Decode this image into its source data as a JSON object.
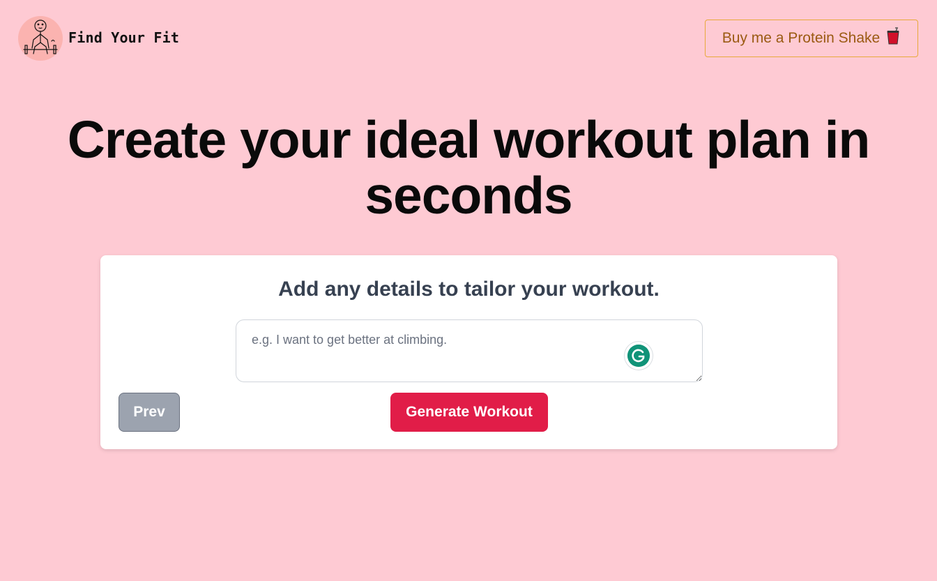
{
  "header": {
    "brand": "Find Your Fit",
    "logo_icon": "weightlifter-icon",
    "shake_button_label": "Buy me a Protein Shake",
    "shake_icon": "cup-icon"
  },
  "hero": {
    "title": "Create your ideal workout plan in seconds"
  },
  "card": {
    "title": "Add any details to tailor your workout.",
    "details_placeholder": "e.g. I want to get better at climbing.",
    "details_value": "",
    "prev_label": "Prev",
    "generate_label": "Generate Workout",
    "assistant_icon": "grammarly-icon"
  },
  "colors": {
    "background": "#fecad3",
    "accent": "#e11d48",
    "shake_border": "#e7a93b",
    "shake_text": "#9a5a12",
    "prev_bg": "#9ca3af"
  }
}
